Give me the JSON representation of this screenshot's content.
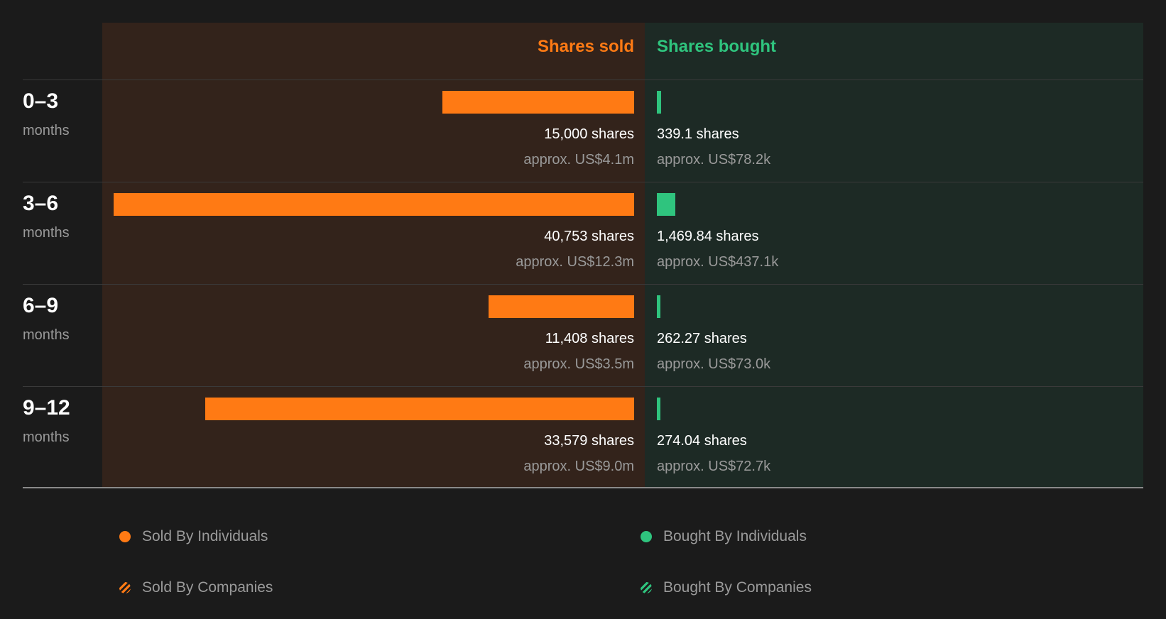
{
  "colors": {
    "sold": "#ff7a14",
    "bought": "#2fc47e",
    "sold_panel": "#33231b",
    "bought_panel": "#1d2a25"
  },
  "chart_data": {
    "type": "bar",
    "orientation": "horizontal-diverging",
    "columns": {
      "sold": "Shares sold",
      "bought": "Shares bought"
    },
    "rows": [
      {
        "label": "0–3",
        "unit": "months",
        "sold_shares": 15000,
        "sold_text": "15,000 shares",
        "sold_value": "approx. US$4.1m",
        "bought_shares": 339.1,
        "bought_text": "339.1 shares",
        "bought_value": "approx. US$78.2k"
      },
      {
        "label": "3–6",
        "unit": "months",
        "sold_shares": 40753,
        "sold_text": "40,753 shares",
        "sold_value": "approx. US$12.3m",
        "bought_shares": 1469.84,
        "bought_text": "1,469.84 shares",
        "bought_value": "approx. US$437.1k"
      },
      {
        "label": "6–9",
        "unit": "months",
        "sold_shares": 11408,
        "sold_text": "11,408 shares",
        "sold_value": "approx. US$3.5m",
        "bought_shares": 262.27,
        "bought_text": "262.27 shares",
        "bought_value": "approx. US$73.0k"
      },
      {
        "label": "9–12",
        "unit": "months",
        "sold_shares": 33579,
        "sold_text": "33,579 shares",
        "sold_value": "approx. US$9.0m",
        "bought_shares": 274.04,
        "bought_text": "274.04 shares",
        "bought_value": "approx. US$72.7k"
      }
    ],
    "legend": [
      {
        "label": "Sold By Individuals",
        "style": "solid-orange"
      },
      {
        "label": "Bought By Individuals",
        "style": "solid-green"
      },
      {
        "label": "Sold By Companies",
        "style": "hatched-orange"
      },
      {
        "label": "Bought By Companies",
        "style": "hatched-green"
      }
    ]
  }
}
